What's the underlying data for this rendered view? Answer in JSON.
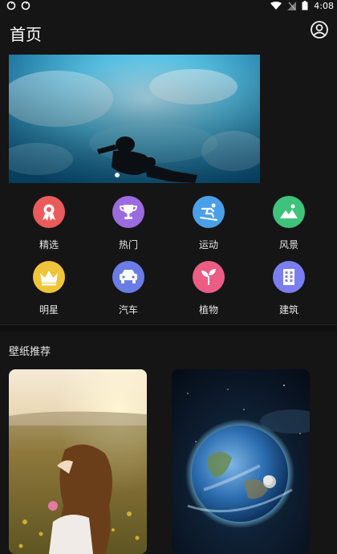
{
  "status_bar": {
    "time": "4:08"
  },
  "header": {
    "title": "首页"
  },
  "categories": [
    {
      "label": "精选",
      "icon": "award-badge-icon",
      "color": "#ea5b5b"
    },
    {
      "label": "热门",
      "icon": "trophy-icon",
      "color": "#9b6be0"
    },
    {
      "label": "运动",
      "icon": "sport-ski-icon",
      "color": "#4aa0e8"
    },
    {
      "label": "风景",
      "icon": "landscape-icon",
      "color": "#3fc27a"
    },
    {
      "label": "明星",
      "icon": "crown-icon",
      "color": "#f0c43a"
    },
    {
      "label": "汽车",
      "icon": "car-icon",
      "color": "#6a7de6"
    },
    {
      "label": "植物",
      "icon": "sprout-icon",
      "color": "#ec5d86"
    },
    {
      "label": "建筑",
      "icon": "building-icon",
      "color": "#7b7ef0"
    }
  ],
  "section": {
    "title": "壁纸推荐"
  }
}
